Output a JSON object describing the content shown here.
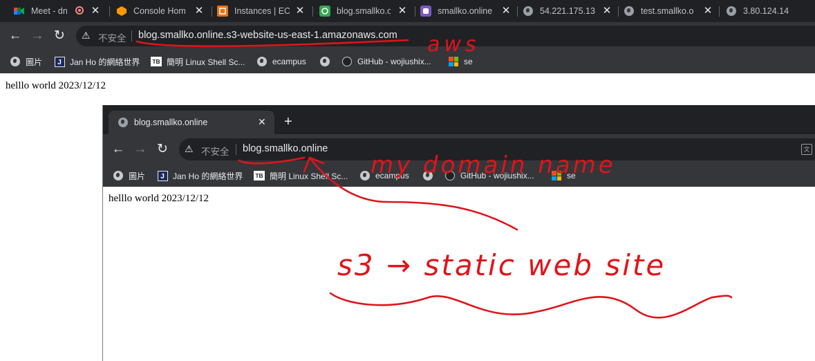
{
  "outer": {
    "tabs": [
      {
        "title": "Meet - dn",
        "icon": "google-meet-icon",
        "recording": true
      },
      {
        "title": "Console Hom",
        "icon": "aws-console-icon"
      },
      {
        "title": "Instances | EC",
        "icon": "ec2-icon"
      },
      {
        "title": "blog.smallko.o",
        "icon": "green-tab-icon"
      },
      {
        "title": "smallko.online",
        "icon": "purple-tab-icon"
      },
      {
        "title": "54.221.175.13",
        "icon": "globe-icon"
      },
      {
        "title": "test.smallko.o",
        "icon": "globe-icon"
      },
      {
        "title": "3.80.124.14",
        "icon": "globe-icon"
      }
    ],
    "omnibox": {
      "security": "不安全",
      "url": "blog.smallko.online.s3-website-us-east-1.amazonaws.com"
    },
    "bookmarks": [
      {
        "label": "圖片",
        "icon": "globe-icon"
      },
      {
        "label": "Jan Ho 的網絡世界",
        "icon": "j-icon"
      },
      {
        "label": "簡明 Linux Shell Sc...",
        "icon": "tb-icon"
      },
      {
        "label": "ecampus",
        "icon": "globe-icon"
      },
      {
        "label": "",
        "icon": "globe-icon"
      },
      {
        "label": "GitHub - wojiushix...",
        "icon": "github-icon"
      },
      {
        "label": "se",
        "icon": "microsoft-icon"
      }
    ],
    "page_text": "helllo world 2023/12/12"
  },
  "inner": {
    "tab_title": "blog.smallko.online",
    "omnibox": {
      "security": "不安全",
      "url": "blog.smallko.online"
    },
    "bookmarks": [
      {
        "label": "圖片",
        "icon": "globe-icon"
      },
      {
        "label": "Jan Ho 的網絡世界",
        "icon": "j-icon"
      },
      {
        "label": "簡明 Linux Shell Sc...",
        "icon": "tb-icon"
      },
      {
        "label": "ecampus",
        "icon": "globe-icon"
      },
      {
        "label": "",
        "icon": "globe-icon"
      },
      {
        "label": "GitHub - wojiushix...",
        "icon": "github-icon"
      },
      {
        "label": "se",
        "icon": "microsoft-icon"
      }
    ],
    "page_text": "helllo world 2023/12/12"
  },
  "annotations": {
    "aws": "aws",
    "my_domain_name": "my domain name",
    "s3_static_website": "s3 → static web site"
  },
  "colors": {
    "annotation_ink": "#e0141b",
    "chrome_dark": "#202124",
    "chrome_toolbar": "#35363a"
  }
}
